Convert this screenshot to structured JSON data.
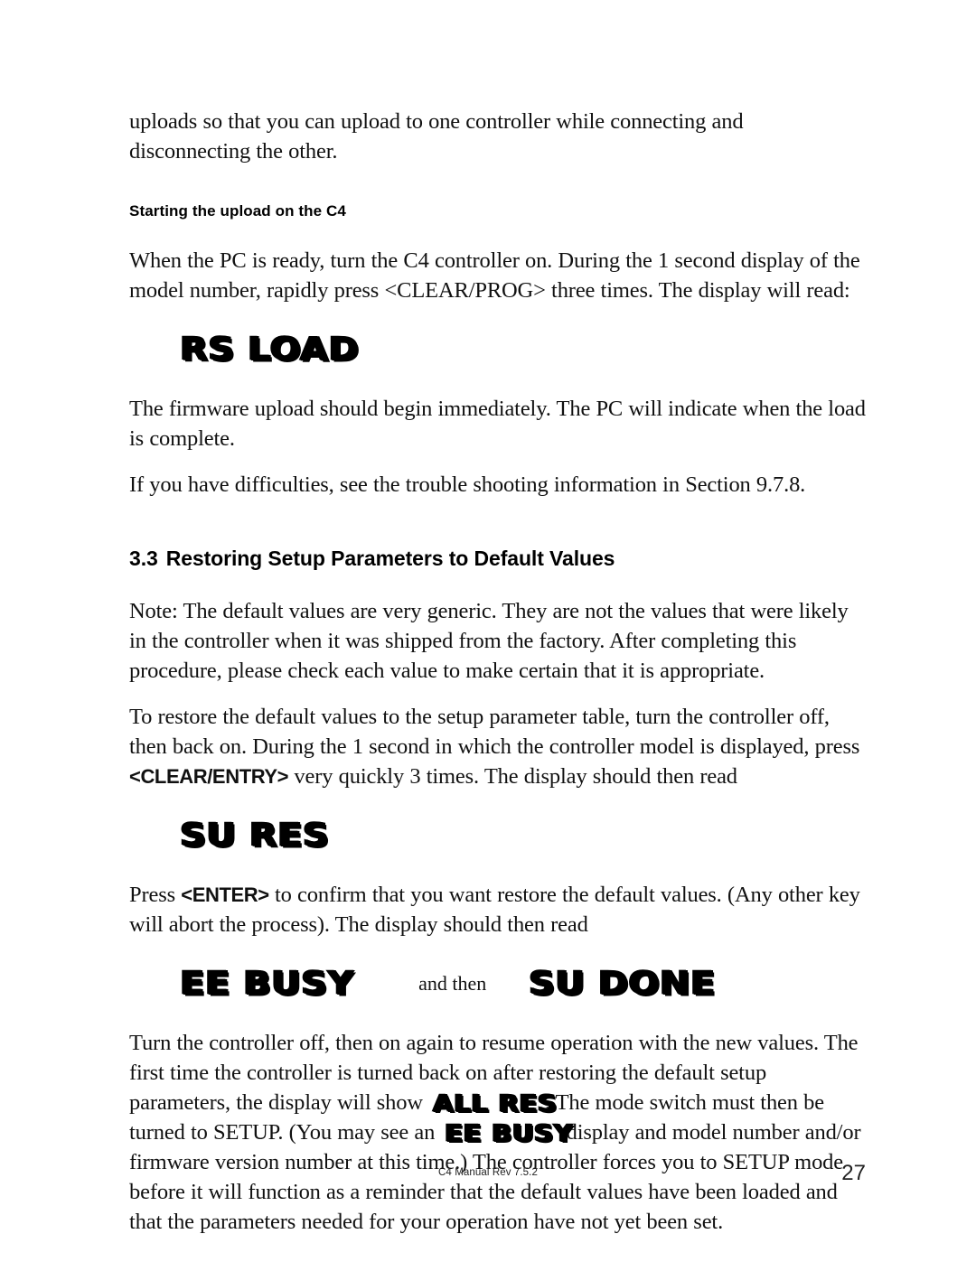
{
  "document": {
    "title": "C4 Manual Rev 7.5.2",
    "page_number": "27"
  },
  "content": {
    "intro_paragraph": "uploads so that you can upload to one controller while connecting and disconnecting the other.",
    "subheading_1": "Starting the upload on the C4",
    "paragraph_2_a": "When the PC is ready, turn the C4 controller on.  During the 1 second display of the model number, rapidly press <CLEAR/PROG> three times.  The display will read:",
    "display_rs_load": "RS LOAD",
    "paragraph_3": "The firmware upload should begin immediately.  The PC will indicate when the load is complete.",
    "paragraph_4": "If you have difficulties, see the trouble shooting information in Section 9.7.8.",
    "section_number": "3.3",
    "section_title": "Restoring Setup Parameters to Default Values",
    "paragraph_5": "Note: The default values are very generic.  They are not the values that were likely in the controller when it was shipped from the factory.  After completing this procedure, please check each value to make certain that it is appropriate.",
    "paragraph_6_pre": "To restore the default values to the setup parameter table, turn the controller off, then back on.  During the 1 second in which the controller model is displayed, press ",
    "paragraph_6_key": "<CLEAR/ENTRY>",
    "paragraph_6_post": " very quickly 3 times.  The display should then read",
    "display_su_res": "SU RES",
    "paragraph_7_pre": "Press ",
    "paragraph_7_key": "<ENTER>",
    "paragraph_7_post": " to confirm that you want restore the default values.  (Any other key will abort the process).  The display should then read",
    "display_ee_busy": "EE BUSY",
    "and_then_label": "and then",
    "display_su_done": "SU DONE",
    "paragraph_8_a": "Turn the controller off, then on again to resume operation with the new values. The first time the controller is turned back on after restoring the default setup parameters, the display will show ",
    "display_all_res": "ALL RES",
    "paragraph_8_b": ".  The mode switch must then be turned to SETUP.  (You may see an ",
    "display_ee_busy_inline": "EE BUSY",
    "paragraph_8_c": " display and model number and/or firmware version number at this time.)  The controller forces you to SETUP mode before it will function as a reminder that the default values have been loaded and that the parameters needed for your operation have not yet been set."
  }
}
